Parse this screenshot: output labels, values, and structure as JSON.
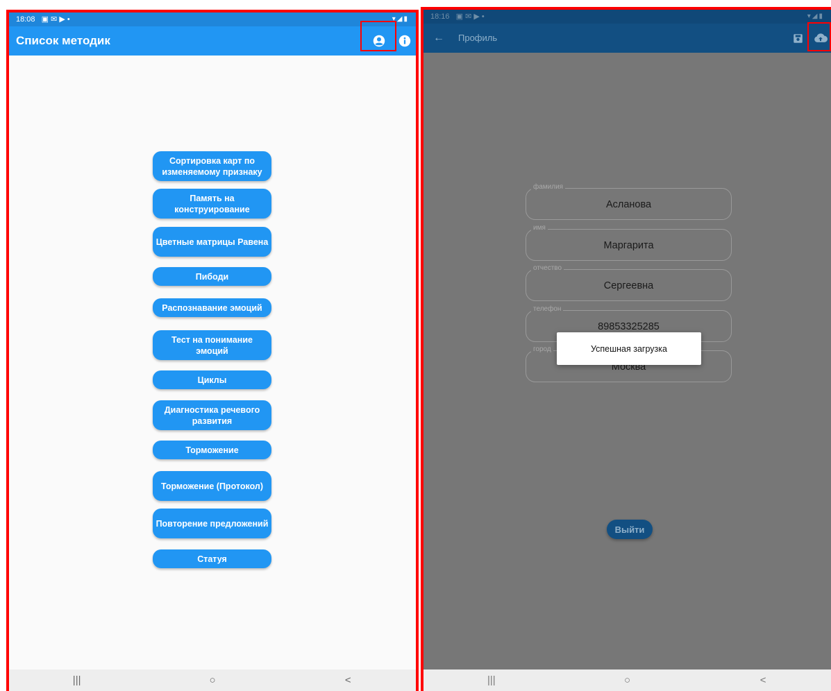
{
  "left_screen": {
    "status_time": "18:08",
    "appbar_title": "Список методик",
    "colors": {
      "primary": "#2196f3",
      "highlight": "#ff0000",
      "background": "#fafafa"
    },
    "actions": {
      "profile_icon": "account-circle-icon",
      "info_icon": "info-icon"
    },
    "methods": [
      {
        "label": "Сортировка карт по изменяемому признаку"
      },
      {
        "label": "Память на конструирование"
      },
      {
        "label": "Цветные матрицы Равена"
      },
      {
        "label": "Пибоди"
      },
      {
        "label": "Распознавание эмоций"
      },
      {
        "label": "Тест на понимание эмоций"
      },
      {
        "label": "Циклы"
      },
      {
        "label": "Диагностика речевого развития"
      },
      {
        "label": "Торможение"
      },
      {
        "label": "Торможение (Протокол)"
      },
      {
        "label": "Повторение предложений"
      },
      {
        "label": "Статуя"
      }
    ],
    "navbar": {
      "recent_glyph": "|||",
      "home_glyph": "○",
      "back_glyph": "<"
    }
  },
  "right_screen": {
    "status_time": "18:16",
    "appbar_title": "Профиль",
    "back_glyph": "←",
    "actions": {
      "save_icon": "save-icon",
      "upload_icon": "cloud-upload-icon"
    },
    "fields": [
      {
        "label": "фамилия",
        "value": "Асланова"
      },
      {
        "label": "имя",
        "value": "Маргарита"
      },
      {
        "label": "отчество",
        "value": "Сергеевна"
      },
      {
        "label": "телефон",
        "value": "89853325285"
      },
      {
        "label": "город",
        "value": "Москва"
      }
    ],
    "toast_text": "Успешная загрузка",
    "logout_label": "Выйти",
    "navbar": {
      "recent_glyph": "|||",
      "home_glyph": "○",
      "back_glyph": "<"
    }
  }
}
